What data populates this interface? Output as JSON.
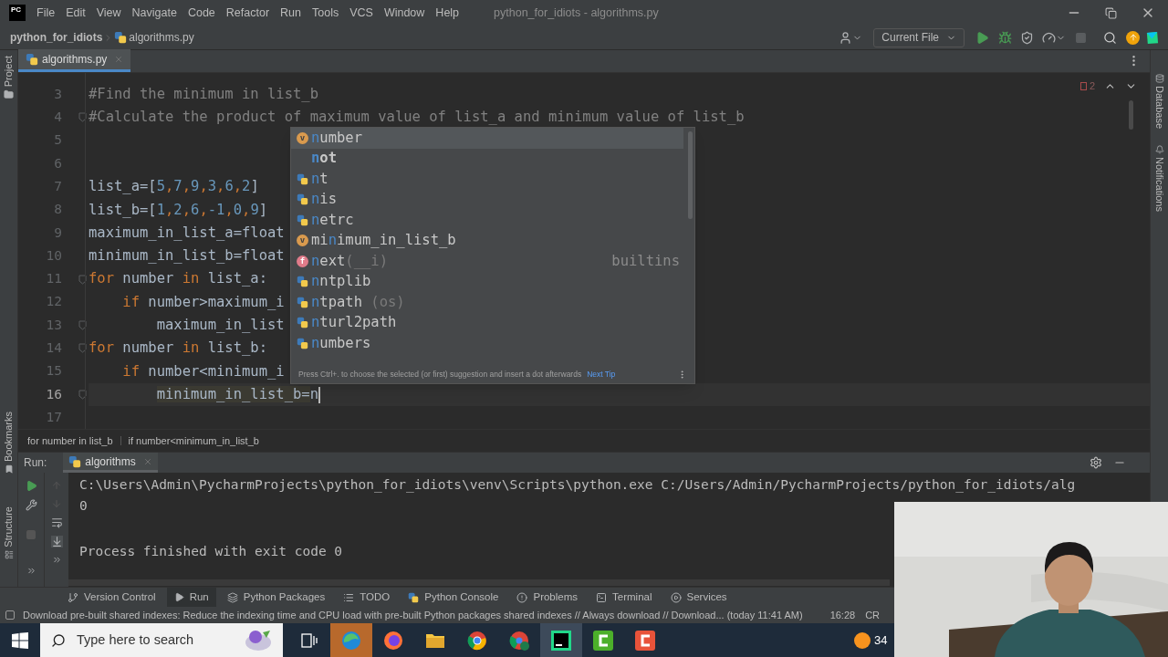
{
  "title_bar": {
    "logo": "PC",
    "menu": [
      "File",
      "Edit",
      "View",
      "Navigate",
      "Code",
      "Refactor",
      "Run",
      "Tools",
      "VCS",
      "Window",
      "Help"
    ],
    "title": "python_for_idiots - algorithms.py"
  },
  "navigation_bar": {
    "project": "python_for_idiots",
    "file": "algorithms.py",
    "run_config": "Current File"
  },
  "left_tool_windows": {
    "top": [
      "Project"
    ],
    "bottom": [
      "Bookmarks",
      "Structure"
    ]
  },
  "right_tool_windows": [
    "Database",
    "Notifications"
  ],
  "editor": {
    "tabs": [
      {
        "label": "algorithms.py",
        "selected": true
      }
    ],
    "problems": "2",
    "lines": [
      {
        "number": "3",
        "fold": false,
        "current": false,
        "segments": [
          {
            "kind": "comment",
            "text": "#Find the minimum in list_b"
          }
        ]
      },
      {
        "number": "4",
        "fold": true,
        "current": false,
        "segments": [
          {
            "kind": "comment",
            "text": "#Calculate the product of maximum value of list_a and minimum value of list_b"
          }
        ]
      },
      {
        "number": "5",
        "fold": false,
        "current": false
      },
      {
        "number": "6",
        "fold": false,
        "current": false
      },
      {
        "number": "7",
        "fold": false,
        "current": false,
        "segments": [
          {
            "kind": "plain",
            "text": "list_a=["
          },
          {
            "kind": "number",
            "text": "5"
          },
          {
            "kind": "punct",
            "text": ","
          },
          {
            "kind": "number",
            "text": "7"
          },
          {
            "kind": "punct",
            "text": ","
          },
          {
            "kind": "number",
            "text": "9"
          },
          {
            "kind": "punct",
            "text": ","
          },
          {
            "kind": "number",
            "text": "3"
          },
          {
            "kind": "punct",
            "text": ","
          },
          {
            "kind": "number",
            "text": "6"
          },
          {
            "kind": "punct",
            "text": ","
          },
          {
            "kind": "number",
            "text": "2"
          },
          {
            "kind": "plain",
            "text": "]"
          }
        ]
      },
      {
        "number": "8",
        "fold": false,
        "current": false,
        "segments": [
          {
            "kind": "plain",
            "text": "list_b=["
          },
          {
            "kind": "number",
            "text": "1"
          },
          {
            "kind": "punct",
            "text": ","
          },
          {
            "kind": "number",
            "text": "2"
          },
          {
            "kind": "punct",
            "text": ","
          },
          {
            "kind": "number",
            "text": "6"
          },
          {
            "kind": "punct",
            "text": ","
          },
          {
            "kind": "number",
            "text": "-1"
          },
          {
            "kind": "punct",
            "text": ","
          },
          {
            "kind": "number",
            "text": "0"
          },
          {
            "kind": "punct",
            "text": ","
          },
          {
            "kind": "number",
            "text": "9"
          },
          {
            "kind": "plain",
            "text": "]"
          }
        ]
      },
      {
        "number": "9",
        "fold": false,
        "current": false,
        "segments": [
          {
            "kind": "plain",
            "text": "maximum_in_list_a=float"
          }
        ]
      },
      {
        "number": "10",
        "fold": false,
        "current": false,
        "segments": [
          {
            "kind": "plain",
            "text": "minimum_in_list_b=float"
          }
        ]
      },
      {
        "number": "11",
        "fold": true,
        "current": false,
        "segments": [
          {
            "kind": "keyword",
            "text": "for"
          },
          {
            "kind": "plain",
            "text": " number "
          },
          {
            "kind": "keyword",
            "text": "in"
          },
          {
            "kind": "plain",
            "text": " list_a:"
          }
        ]
      },
      {
        "number": "12",
        "fold": false,
        "current": false,
        "segments": [
          {
            "kind": "keyword",
            "text": "    if"
          },
          {
            "kind": "plain",
            "text": " number>maximum_i"
          }
        ]
      },
      {
        "number": "13",
        "fold": true,
        "current": false,
        "segments": [
          {
            "kind": "plain",
            "text": "        maximum_in_list"
          }
        ]
      },
      {
        "number": "14",
        "fold": true,
        "current": false,
        "segments": [
          {
            "kind": "keyword",
            "text": "for"
          },
          {
            "kind": "plain",
            "text": " number "
          },
          {
            "kind": "keyword",
            "text": "in"
          },
          {
            "kind": "plain",
            "text": " list_b:"
          }
        ]
      },
      {
        "number": "15",
        "fold": false,
        "current": false,
        "segments": [
          {
            "kind": "keyword",
            "text": "    if"
          },
          {
            "kind": "plain",
            "text": " number<minimum_i"
          }
        ]
      },
      {
        "number": "16",
        "fold": true,
        "current": true,
        "segments": [
          {
            "kind": "highlight",
            "text": "        minimum_in_list_b="
          },
          {
            "kind": "plain",
            "text": "n"
          }
        ]
      },
      {
        "number": "17",
        "fold": false,
        "current": false
      }
    ]
  },
  "completion_popup": {
    "items": [
      {
        "kind": "variable",
        "badge": "v",
        "selected": true,
        "parts": [
          {
            "text": "n",
            "match": true
          },
          {
            "text": "umber",
            "match": false
          }
        ]
      },
      {
        "kind": "keyword",
        "selected": false,
        "parts": [
          {
            "text": "n",
            "match": true
          },
          {
            "text": "ot",
            "match": false
          }
        ]
      },
      {
        "kind": "module",
        "selected": false,
        "parts": [
          {
            "text": "n",
            "match": true
          },
          {
            "text": "t",
            "match": false
          }
        ]
      },
      {
        "kind": "module",
        "selected": false,
        "parts": [
          {
            "text": "n",
            "match": true
          },
          {
            "text": "is",
            "match": false
          }
        ]
      },
      {
        "kind": "module",
        "selected": false,
        "parts": [
          {
            "text": "n",
            "match": true
          },
          {
            "text": "etrc",
            "match": false
          }
        ]
      },
      {
        "kind": "variable",
        "badge": "v",
        "selected": false,
        "parts": [
          {
            "text": "mi",
            "match": false
          },
          {
            "text": "n",
            "match": true
          },
          {
            "text": "imum_in_list_b",
            "match": false
          }
        ]
      },
      {
        "kind": "function",
        "badge": "f",
        "selected": false,
        "parts": [
          {
            "text": "n",
            "match": true
          },
          {
            "text": "ext",
            "match": false
          }
        ],
        "hint": "(__i)",
        "source": "builtins"
      },
      {
        "kind": "module",
        "selected": false,
        "parts": [
          {
            "text": "n",
            "match": true
          },
          {
            "text": "ntplib",
            "match": false
          }
        ]
      },
      {
        "kind": "module",
        "selected": false,
        "parts": [
          {
            "text": "n",
            "match": true
          },
          {
            "text": "tpath",
            "match": false
          }
        ],
        "hint": " (os)"
      },
      {
        "kind": "module",
        "selected": false,
        "parts": [
          {
            "text": "n",
            "match": true
          },
          {
            "text": "turl2path",
            "match": false
          }
        ]
      },
      {
        "kind": "module",
        "selected": false,
        "parts": [
          {
            "text": "n",
            "match": true
          },
          {
            "text": "umbers",
            "match": false
          }
        ]
      }
    ],
    "footer": "Press Ctrl+. to choose the selected (or first) suggestion and insert a dot afterwards",
    "next_tip": "Next Tip"
  },
  "breadcrumbs": [
    "for number in list_b",
    "if number<minimum_in_list_b"
  ],
  "run_panel": {
    "label": "Run:",
    "tabs": [
      {
        "label": "algorithms",
        "selected": true
      }
    ],
    "output": [
      {
        "text": "C:\\Users\\Admin\\PycharmProjects\\python_for_idiots\\venv\\Scripts\\python.exe C:/Users/Admin/PycharmProjects/python_for_idiots/alg",
        "gap_before": false
      },
      {
        "text": "0",
        "gap_before": false
      },
      {
        "text": "Process finished with exit code 0",
        "gap_before": true
      }
    ]
  },
  "tool_tabs": [
    {
      "label": "Version Control",
      "kind": "branch",
      "selected": false
    },
    {
      "label": "Run",
      "kind": "play",
      "selected": true
    },
    {
      "label": "Python Packages",
      "kind": "layers",
      "selected": false
    },
    {
      "label": "TODO",
      "kind": "list",
      "selected": false
    },
    {
      "label": "Python Console",
      "kind": "python",
      "selected": false
    },
    {
      "label": "Problems",
      "kind": "alert",
      "selected": false
    },
    {
      "label": "Terminal",
      "kind": "terminal",
      "selected": false
    },
    {
      "label": "Services",
      "kind": "services",
      "selected": false
    }
  ],
  "status_bar": {
    "message": "Download pre-built shared indexes: Reduce the indexing time and CPU load with pre-built Python packages shared indexes // Always download // Download... (today 11:41 AM)",
    "position": "16:28",
    "line_separator": "CR"
  },
  "taskbar": {
    "search_placeholder": "Type here to search",
    "apps": [
      {
        "kind": "taskview",
        "active": false
      },
      {
        "kind": "edge",
        "active": true
      },
      {
        "kind": "firefox",
        "active": false
      },
      {
        "kind": "folder",
        "active": false
      },
      {
        "kind": "chrome",
        "active": false
      },
      {
        "kind": "chrome-profile",
        "active": false
      },
      {
        "kind": "pycharm",
        "active": true
      },
      {
        "kind": "camtasia-green",
        "active": false
      },
      {
        "kind": "camtasia-red",
        "active": false
      }
    ],
    "temperature": "34"
  },
  "webcam": {
    "kind": "picture"
  }
}
